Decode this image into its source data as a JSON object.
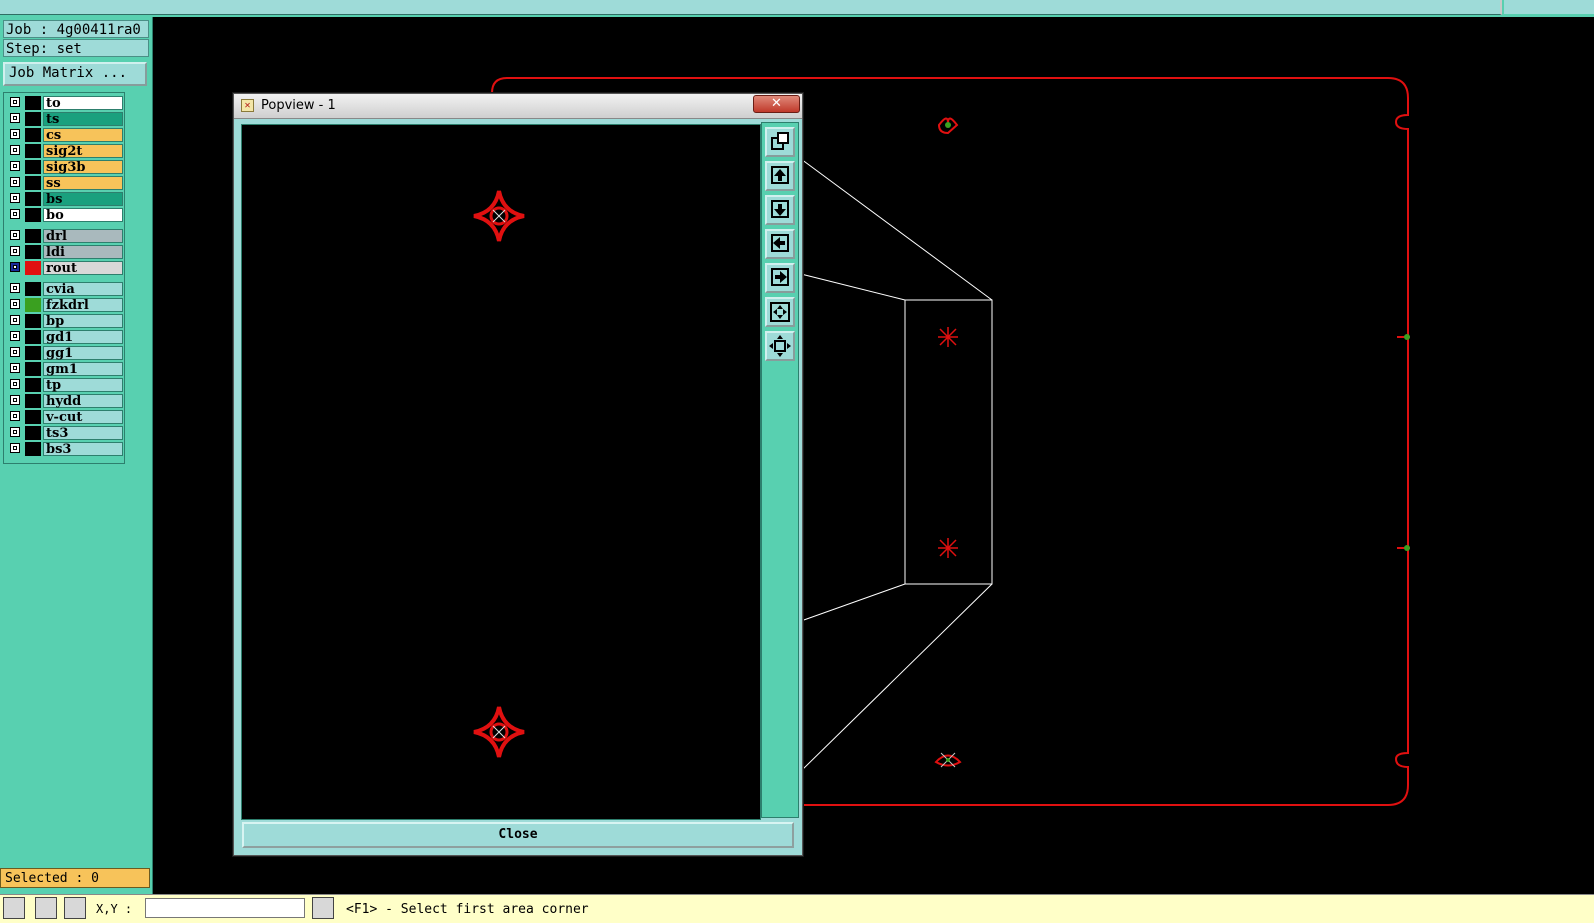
{
  "job": {
    "job_line": "Job : 4g00411ra0",
    "step_line": "Step: set",
    "matrix_button": "Job Matrix ..."
  },
  "layers": [
    {
      "name": "to",
      "color": "#ffffff",
      "swatch": "#000000"
    },
    {
      "name": "ts",
      "color": "#1aa07e",
      "swatch": "#000000"
    },
    {
      "name": "cs",
      "color": "#f7c35a",
      "swatch": "#000000"
    },
    {
      "name": "sig2t",
      "color": "#f7c35a",
      "swatch": "#000000"
    },
    {
      "name": "sig3b",
      "color": "#f7c35a",
      "swatch": "#000000"
    },
    {
      "name": "ss",
      "color": "#f7c35a",
      "swatch": "#000000"
    },
    {
      "name": "bs",
      "color": "#1aa07e",
      "swatch": "#000000"
    },
    {
      "name": "bo",
      "color": "#ffffff",
      "swatch": "#000000"
    },
    {
      "name": "drl",
      "color": "#a9b9bd",
      "swatch": "#000000"
    },
    {
      "name": "ldi",
      "color": "#a9b9bd",
      "swatch": "#000000"
    },
    {
      "name": "rout",
      "color": "#d8d8d8",
      "swatch": "#e01010",
      "active": true
    },
    {
      "name": "cvia",
      "color": "#9edbd8",
      "swatch": "#000000"
    },
    {
      "name": "fzkdrl",
      "color": "#9edbd8",
      "swatch": "#3aa020"
    },
    {
      "name": "bp",
      "color": "#9edbd8",
      "swatch": "#000000"
    },
    {
      "name": "gd1",
      "color": "#9edbd8",
      "swatch": "#000000"
    },
    {
      "name": "gg1",
      "color": "#9edbd8",
      "swatch": "#000000"
    },
    {
      "name": "gm1",
      "color": "#9edbd8",
      "swatch": "#000000"
    },
    {
      "name": "tp",
      "color": "#9edbd8",
      "swatch": "#000000"
    },
    {
      "name": "hydd",
      "color": "#9edbd8",
      "swatch": "#000000"
    },
    {
      "name": "v-cut",
      "color": "#9edbd8",
      "swatch": "#000000"
    },
    {
      "name": "ts3",
      "color": "#9edbd8",
      "swatch": "#000000"
    },
    {
      "name": "bs3",
      "color": "#9edbd8",
      "swatch": "#000000"
    }
  ],
  "selected": "Selected : 0",
  "bottom": {
    "xy_label": "X,Y :",
    "prompt": "<F1> - Select first area corner"
  },
  "popview": {
    "title": "Popview - 1",
    "close_x": "✕",
    "close_button": "Close"
  },
  "colors": {
    "accent": "#58d0b0",
    "panel": "#9edbd8",
    "rout": "#e01010",
    "highlight": "#f7c35a"
  }
}
